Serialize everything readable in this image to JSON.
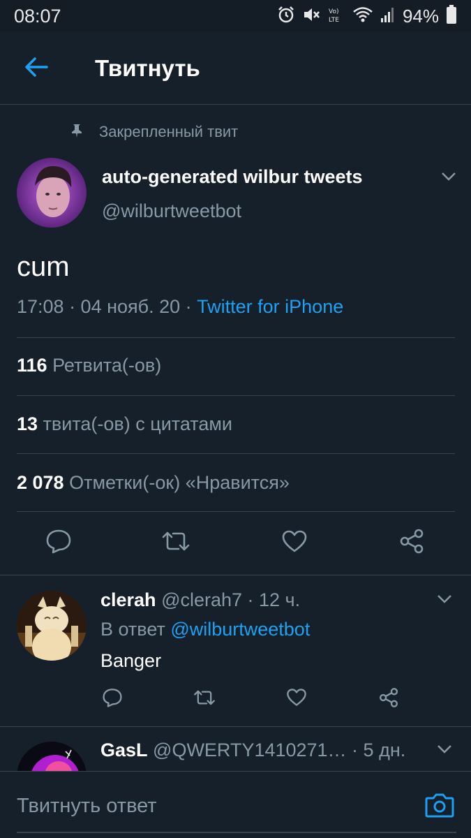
{
  "status_bar": {
    "time": "08:07",
    "battery": "94%",
    "icons": [
      "alarm-icon",
      "mute-icon",
      "volte-icon",
      "wifi-icon",
      "signal-icon",
      "battery-icon"
    ]
  },
  "header": {
    "title": "Твитнуть",
    "back_icon": "arrow-left-icon"
  },
  "tweet": {
    "pinned_label": "Закрепленный твит",
    "author_name": "auto-generated wilbur tweets",
    "author_handle": "@wilburtweetbot",
    "text": "cum",
    "time_date": "17:08 · 04 нояб. 20 · ",
    "source": "Twitter for iPhone",
    "stats": {
      "retweets_count": "116",
      "retweets_label": " Ретвита(-ов)",
      "quotes_count": "13",
      "quotes_label": " твита(-ов) с цитатами",
      "likes_count": "2 078",
      "likes_label": " Отметки(-ок) «Нравится»"
    },
    "actions": [
      "reply-icon",
      "retweet-icon",
      "like-icon",
      "share-icon"
    ]
  },
  "replies": [
    {
      "name": "clerah",
      "handle_time": " @clerah7 · 12 ч.",
      "context_prefix": "В ответ ",
      "context_mention": "@wilburtweetbot",
      "text": "Banger"
    },
    {
      "name": "GasL",
      "handle_time": " @QWERTY1410271… · 5 дн."
    }
  ],
  "compose": {
    "placeholder": "Твитнуть ответ"
  },
  "colors": {
    "background": "#15202b",
    "accent": "#1da1f2",
    "secondary_text": "#8899a6",
    "divider": "#38444d"
  }
}
